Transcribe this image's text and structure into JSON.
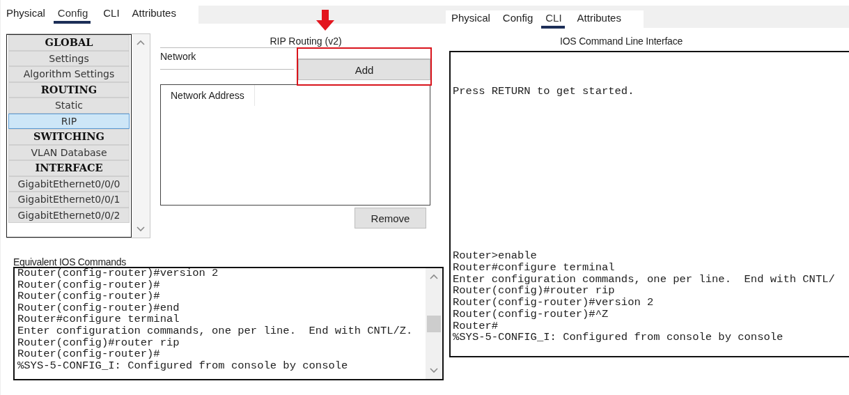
{
  "config_panel": {
    "tabs": [
      {
        "label": "Physical",
        "selected": false
      },
      {
        "label": "Config",
        "selected": true
      },
      {
        "label": "CLI",
        "selected": false
      },
      {
        "label": "Attributes",
        "selected": false
      }
    ],
    "sidebar": {
      "items": [
        {
          "kind": "header",
          "label": "GLOBAL",
          "selected": false
        },
        {
          "kind": "item",
          "label": "Settings",
          "selected": false
        },
        {
          "kind": "item",
          "label": "Algorithm Settings",
          "selected": false
        },
        {
          "kind": "header",
          "label": "ROUTING",
          "selected": false
        },
        {
          "kind": "item",
          "label": "Static",
          "selected": false
        },
        {
          "kind": "item",
          "label": "RIP",
          "selected": true
        },
        {
          "kind": "header",
          "label": "SWITCHING",
          "selected": false
        },
        {
          "kind": "item",
          "label": "VLAN Database",
          "selected": false
        },
        {
          "kind": "header",
          "label": "INTERFACE",
          "selected": false
        },
        {
          "kind": "item",
          "label": "GigabitEthernet0/0/0",
          "selected": false
        },
        {
          "kind": "item",
          "label": "GigabitEthernet0/0/1",
          "selected": false
        },
        {
          "kind": "item",
          "label": "GigabitEthernet0/0/2",
          "selected": false
        }
      ]
    },
    "form": {
      "title": "RIP Routing (v2)",
      "network_label": "Network",
      "add_button": "Add",
      "highlighted": true,
      "table": {
        "columns": [
          "Network Address"
        ]
      },
      "remove_button": "Remove"
    },
    "equivalent_commands": {
      "label": "Equivalent IOS Commands",
      "lines": [
        "Router(config-router)#version 2",
        "Router(config-router)#",
        "Router(config-router)#",
        "Router(config-router)#end",
        "Router#configure terminal",
        "Enter configuration commands, one per line.  End with CNTL/Z.",
        "Router(config)#router rip",
        "Router(config-router)#",
        "%SYS-5-CONFIG_I: Configured from console by console"
      ]
    }
  },
  "cli_panel": {
    "tabs": [
      {
        "label": "Physical",
        "selected": false
      },
      {
        "label": "Config",
        "selected": false
      },
      {
        "label": "CLI",
        "selected": true
      },
      {
        "label": "Attributes",
        "selected": false
      }
    ],
    "title": "IOS Command Line Interface",
    "intro": "Press RETURN to get started.",
    "lines": [
      "Router>enable",
      "Router#configure terminal",
      "Enter configuration commands, one per line.  End with CNTL/",
      "Router(config)#router rip",
      "Router(config-router)#version 2",
      "Router(config-router)#^Z",
      "Router#",
      "%SYS-5-CONFIG_I: Configured from console by console"
    ]
  }
}
